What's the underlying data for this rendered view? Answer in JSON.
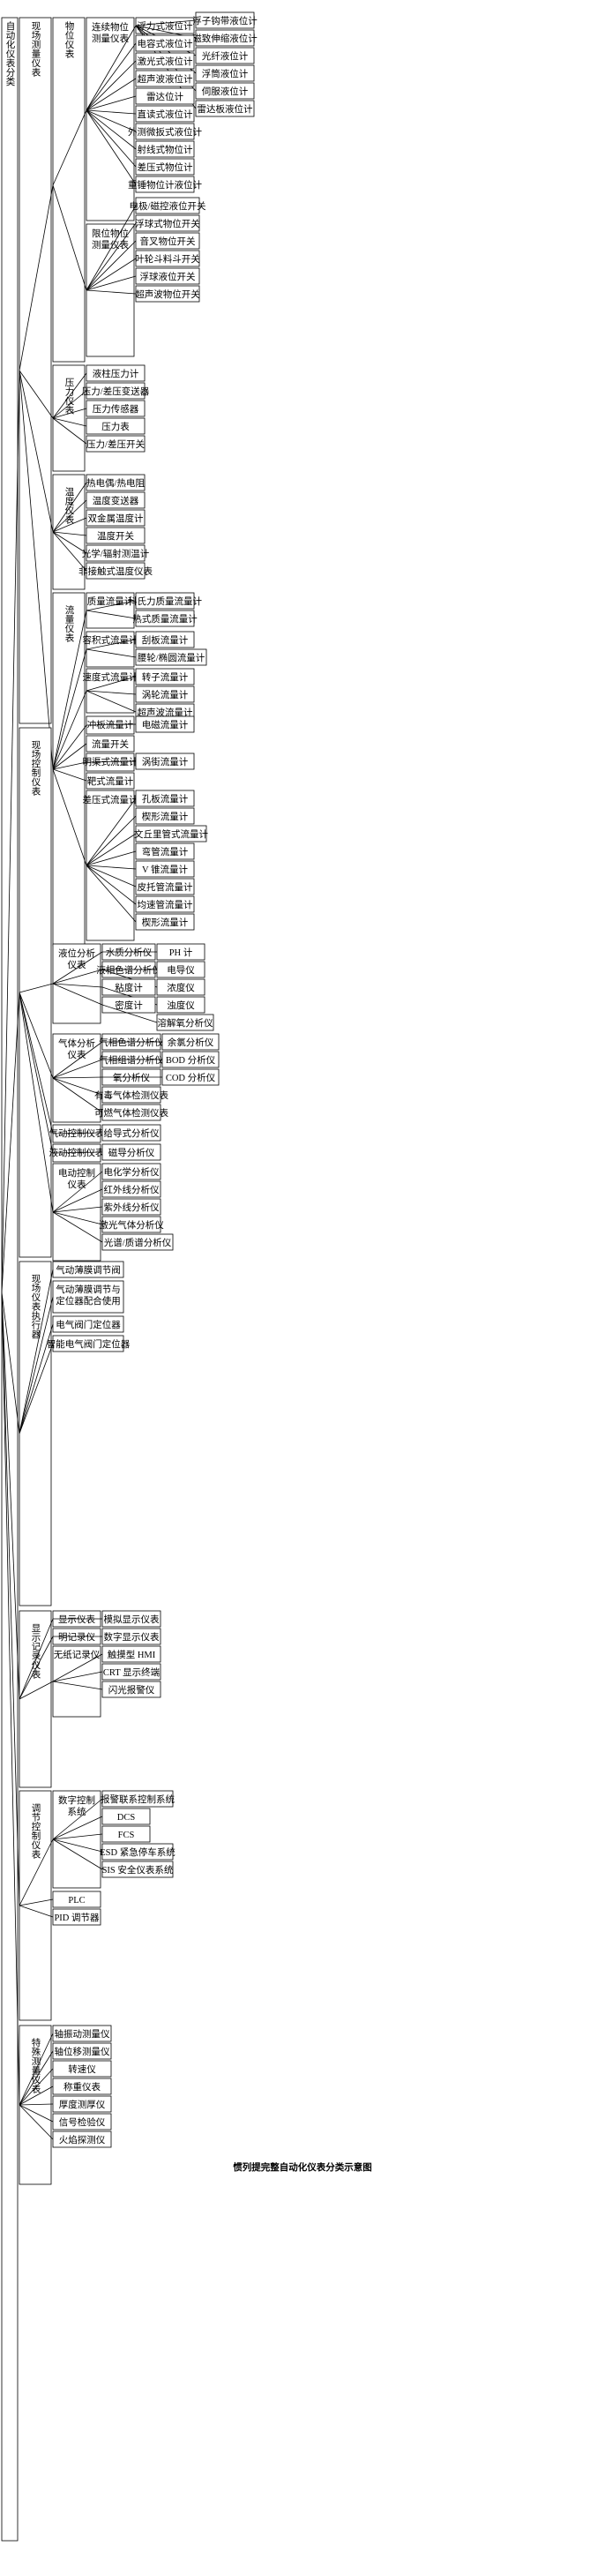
{
  "title": "惯列提完整自动化仪表分类示意图",
  "tree": {
    "root": "自动化仪表分类",
    "level1": [
      {
        "label": "现场测量仪表",
        "level2": [
          {
            "label": "物位仪表",
            "level3": [
              {
                "label": "连续物位测量仪表",
                "level4": [
                  {
                    "label": "浮力式液位计",
                    "level5": [
                      "浮子钩带液位计",
                      "磁致伸缩液位计",
                      "光纤液位计",
                      "浮筒液位计",
                      "伺服液位计",
                      "雷达板液位计"
                    ]
                  },
                  {
                    "label": "电容式液位计",
                    "level5": []
                  },
                  {
                    "label": "激光式液位计",
                    "level5": []
                  },
                  {
                    "label": "超声波液位计",
                    "level5": []
                  },
                  {
                    "label": "雷达位计",
                    "level5": []
                  },
                  {
                    "label": "直读式液位计",
                    "level5": []
                  },
                  {
                    "label": "外测微扳式液位计",
                    "level5": []
                  },
                  {
                    "label": "射线式物位计",
                    "level5": []
                  },
                  {
                    "label": "差压式物位计",
                    "level5": []
                  },
                  {
                    "label": "重锤物位计液位计",
                    "level5": []
                  }
                ]
              },
              {
                "label": "限位物位测量仪表",
                "level4": [
                  {
                    "label": "电极/磁控液位开关",
                    "level5": []
                  },
                  {
                    "label": "浮球式物位开关",
                    "level5": []
                  },
                  {
                    "label": "音叉物位开关",
                    "level5": []
                  },
                  {
                    "label": "叶轮斗料斗开关",
                    "level5": []
                  },
                  {
                    "label": "浮球液位开关",
                    "level5": []
                  },
                  {
                    "label": "超声波物位开关",
                    "level5": []
                  }
                ]
              }
            ]
          },
          {
            "label": "压力仪表",
            "level3": [
              {
                "label": "液柱压力计",
                "level4": []
              },
              {
                "label": "压力/差压变送器",
                "level4": []
              },
              {
                "label": "压力传感器",
                "level4": []
              },
              {
                "label": "压力表",
                "level4": []
              },
              {
                "label": "压力/差压开关",
                "level4": []
              }
            ]
          },
          {
            "label": "温度仪表",
            "level3": [
              {
                "label": "热电偶/热电阻",
                "level4": []
              },
              {
                "label": "温度变送器",
                "level4": []
              },
              {
                "label": "双金属温度计",
                "level4": []
              },
              {
                "label": "温度开关",
                "level4": []
              },
              {
                "label": "光学/辐射测温计",
                "level4": []
              },
              {
                "label": "非接触式温度仪表",
                "level4": []
              }
            ]
          },
          {
            "label": "流量仪表",
            "level3": [
              {
                "label": "质量流量计",
                "level4": [
                  {
                    "label": "科氏力质量流量计",
                    "level5": []
                  },
                  {
                    "label": "热式质量流量计",
                    "level5": []
                  }
                ]
              },
              {
                "label": "容积式流量计",
                "level4": [
                  {
                    "label": "刮板流量计",
                    "level5": []
                  },
                  {
                    "label": "腰轮流量/椭圆流量计",
                    "level5": []
                  }
                ]
              },
              {
                "label": "速度式流量计",
                "level4": [
                  {
                    "label": "转子流量计",
                    "level5": []
                  },
                  {
                    "label": "涡轮流量计",
                    "level5": []
                  },
                  {
                    "label": "超声波流量计",
                    "level5": []
                  }
                ]
              },
              {
                "label": "冲板流量计",
                "level4": [
                  {
                    "label": "电磁流量计",
                    "level5": []
                  }
                ]
              },
              {
                "label": "流量开关",
                "level4": []
              },
              {
                "label": "明渠式流量计",
                "level4": [
                  {
                    "label": "涡街流量计",
                    "level5": []
                  }
                ]
              },
              {
                "label": "靶式流量计",
                "level4": []
              },
              {
                "label": "差压式流量计",
                "level4": [
                  {
                    "label": "孔板流量计",
                    "level5": []
                  },
                  {
                    "label": "楔形流量计",
                    "level5": []
                  },
                  {
                    "label": "文丘里管式流量计",
                    "level5": []
                  },
                  {
                    "label": "弯管流量计",
                    "level5": []
                  },
                  {
                    "label": "V 锥流量计",
                    "level5": []
                  },
                  {
                    "label": "皮托管流量计",
                    "level5": []
                  },
                  {
                    "label": "均速管流量计",
                    "level5": []
                  },
                  {
                    "label": "楔形流量计2",
                    "level5": []
                  }
                ]
              }
            ]
          }
        ]
      },
      {
        "label": "现场控制仪表",
        "level2": [
          {
            "label": "液位分析仪表",
            "level3": [
              {
                "label": "水质分析仪",
                "level4": [
                  {
                    "label": "PH 计",
                    "level5": []
                  }
                ]
              },
              {
                "label": "液相色谱分析仪",
                "level4": [
                  {
                    "label": "电导仪",
                    "level5": []
                  },
                  {
                    "label": "浓度仪",
                    "level5": []
                  }
                ]
              },
              {
                "label": "粘度计",
                "level4": [
                  {
                    "label": "浊度仪",
                    "level5": []
                  }
                ]
              },
              {
                "label": "密度计",
                "level4": [
                  {
                    "label": "溶解氧分析仪",
                    "level5": []
                  }
                ]
              }
            ]
          },
          {
            "label": "气体分析仪表",
            "level3": [
              {
                "label": "气相色谱分析仪",
                "level4": [
                  {
                    "label": "余氯分析仪",
                    "level5": []
                  }
                ]
              },
              {
                "label": "气相组谱分析仪",
                "level4": [
                  {
                    "label": "BOD 分析仪",
                    "level5": []
                  }
                ]
              },
              {
                "label": "氧分析仪",
                "level4": [
                  {
                    "label": "COD 分析仪",
                    "level5": []
                  }
                ]
              },
              {
                "label": "有毒气体检测仪表",
                "level4": []
              },
              {
                "label": "可燃气体检测仪表",
                "level4": []
              }
            ]
          },
          {
            "label": "气动控制仪表",
            "level3": [
              {
                "label": "给导式分析仪",
                "level4": []
              }
            ]
          },
          {
            "label": "液动控制仪表",
            "level3": [
              {
                "label": "磁导分析仪",
                "level5": []
              }
            ]
          },
          {
            "label": "电动控制仪表",
            "level3": [
              {
                "label": "电化学分析仪",
                "level4": []
              },
              {
                "label": "红外线分析仪",
                "level4": []
              },
              {
                "label": "紫外线分析仪",
                "level4": []
              },
              {
                "label": "激光气体分析仪",
                "level4": []
              },
              {
                "label": "光谱/质谱分析仪",
                "level4": []
              }
            ]
          }
        ]
      },
      {
        "label": "现场仪表执行器",
        "level2": [
          {
            "label": "气动薄膜调节阀",
            "level3": []
          },
          {
            "label": "气动薄膜调节与定位器配合使用",
            "level3": []
          },
          {
            "label": "电气阀门定位器",
            "level3": []
          },
          {
            "label": "智能电气阀门定位器",
            "level3": []
          }
        ]
      },
      {
        "label": "显示记录仪表",
        "level2": [
          {
            "label": "显示仪表",
            "level3": [
              {
                "label": "模拟显示仪表",
                "level4": []
              }
            ]
          },
          {
            "label": "明记录仪",
            "level3": [
              {
                "label": "数字显示仪表",
                "level4": []
              }
            ]
          },
          {
            "label": "无纸记录仪",
            "level3": [
              {
                "label": "触摸型 HMI",
                "level4": []
              },
              {
                "label": "CRT 显示终端",
                "level4": []
              },
              {
                "label": "闪光报警仪",
                "level4": []
              }
            ]
          }
        ]
      },
      {
        "label": "调节控制仪表",
        "level2": [
          {
            "label": "数字控制系统",
            "level3": [
              {
                "label": "报警联系控制系统",
                "level4": []
              },
              {
                "label": "DCS",
                "level4": []
              },
              {
                "label": "FCS",
                "level4": []
              },
              {
                "label": "ESD 紧急停车系统",
                "level4": []
              },
              {
                "label": "SIS 安全仪表系统",
                "level4": []
              }
            ]
          },
          {
            "label": "PLC",
            "level3": []
          },
          {
            "label": "PID 调节器",
            "level3": []
          }
        ]
      },
      {
        "label": "特殊测量仪表",
        "level2": [
          {
            "label": "轴振动测量仪",
            "level3": []
          },
          {
            "label": "轴位移测量仪",
            "level3": []
          },
          {
            "label": "转速仪",
            "level3": []
          },
          {
            "label": "称重仪表",
            "level3": []
          },
          {
            "label": "厚度测厚仪",
            "level3": []
          },
          {
            "label": "信号检验仪",
            "level3": []
          },
          {
            "label": "火焰探测仪",
            "level3": []
          }
        ]
      }
    ]
  }
}
